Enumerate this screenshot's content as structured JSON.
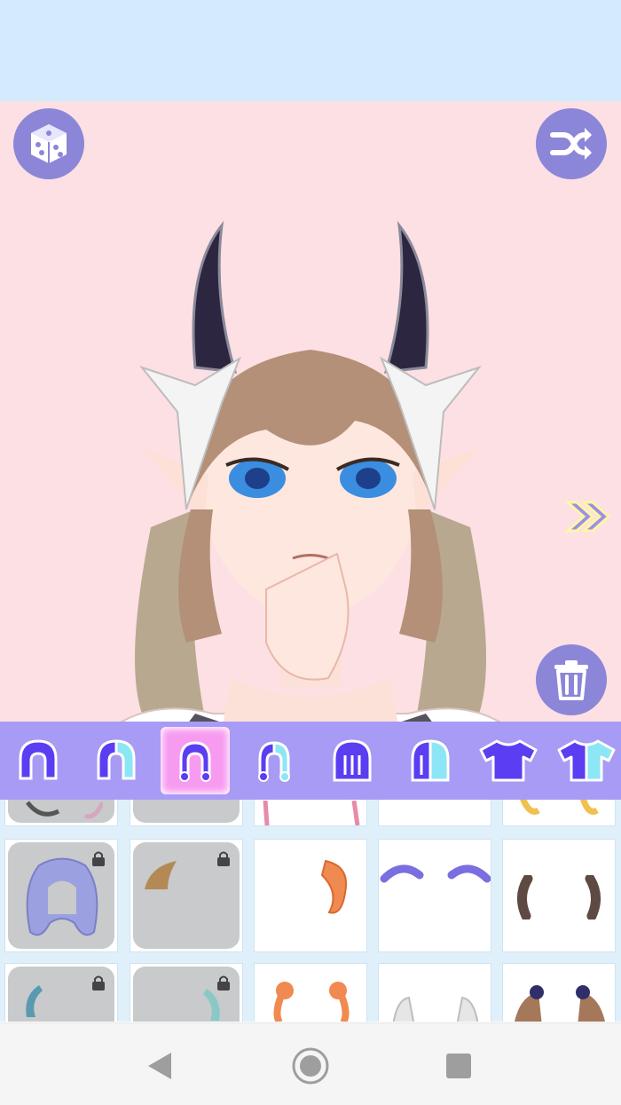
{
  "app": {
    "top_banner": "",
    "buttons": {
      "random": "dice-icon",
      "shuffle": "shuffle-icon",
      "next": "double-chevron-right-icon",
      "delete": "trash-icon"
    }
  },
  "categories": [
    {
      "id": "hair-full",
      "icon": "hair-full-icon",
      "active": false
    },
    {
      "id": "hair-half",
      "icon": "hair-half-icon",
      "active": false
    },
    {
      "id": "hair-twintail",
      "icon": "hair-twintail-icon",
      "active": true
    },
    {
      "id": "hair-twintail-half",
      "icon": "hair-twintail-half-icon",
      "active": false
    },
    {
      "id": "hair-long",
      "icon": "hair-long-icon",
      "active": false
    },
    {
      "id": "hair-long-half",
      "icon": "hair-long-half-icon",
      "active": false
    },
    {
      "id": "shirt",
      "icon": "shirt-icon",
      "active": false
    },
    {
      "id": "shirt-half",
      "icon": "shirt-half-icon",
      "active": false
    }
  ],
  "items": [
    {
      "row": 0,
      "col": 0,
      "locked": true,
      "preview": "dark-hair-accessory"
    },
    {
      "row": 0,
      "col": 1,
      "locked": true,
      "preview": "none"
    },
    {
      "row": 0,
      "col": 2,
      "locked": false,
      "preview": "pink-tails"
    },
    {
      "row": 0,
      "col": 3,
      "locked": false,
      "preview": "none"
    },
    {
      "row": 0,
      "col": 4,
      "locked": false,
      "preview": "blonde-tails"
    },
    {
      "row": 1,
      "col": 0,
      "locked": true,
      "preview": "lavender-curly-hair"
    },
    {
      "row": 1,
      "col": 1,
      "locked": true,
      "preview": "brown-ponytail"
    },
    {
      "row": 1,
      "col": 2,
      "locked": false,
      "preview": "orange-ponytail"
    },
    {
      "row": 1,
      "col": 3,
      "locked": false,
      "preview": "purple-braids"
    },
    {
      "row": 1,
      "col": 4,
      "locked": false,
      "preview": "brown-tails"
    },
    {
      "row": 2,
      "col": 0,
      "locked": true,
      "preview": "teal-tail"
    },
    {
      "row": 2,
      "col": 1,
      "locked": true,
      "preview": "teal-tail-2"
    },
    {
      "row": 2,
      "col": 2,
      "locked": false,
      "preview": "orange-buns"
    },
    {
      "row": 2,
      "col": 3,
      "locked": false,
      "preview": "white-buns"
    },
    {
      "row": 2,
      "col": 4,
      "locked": false,
      "preview": "bows-hair"
    }
  ],
  "navbar": {
    "back": "back-triangle-icon",
    "home": "home-circle-icon",
    "recents": "recents-square-icon"
  },
  "colors": {
    "top_banner": "#d4ebfd",
    "stage_bg": "#fde0e3",
    "button_bg": "#8b86d8",
    "category_bar": "#a79bf5",
    "category_active": "#f79bf0",
    "icon_fill": "#5b3df2",
    "grid_bg": "#dff0fb",
    "locked_tile": "#c8cacb"
  }
}
